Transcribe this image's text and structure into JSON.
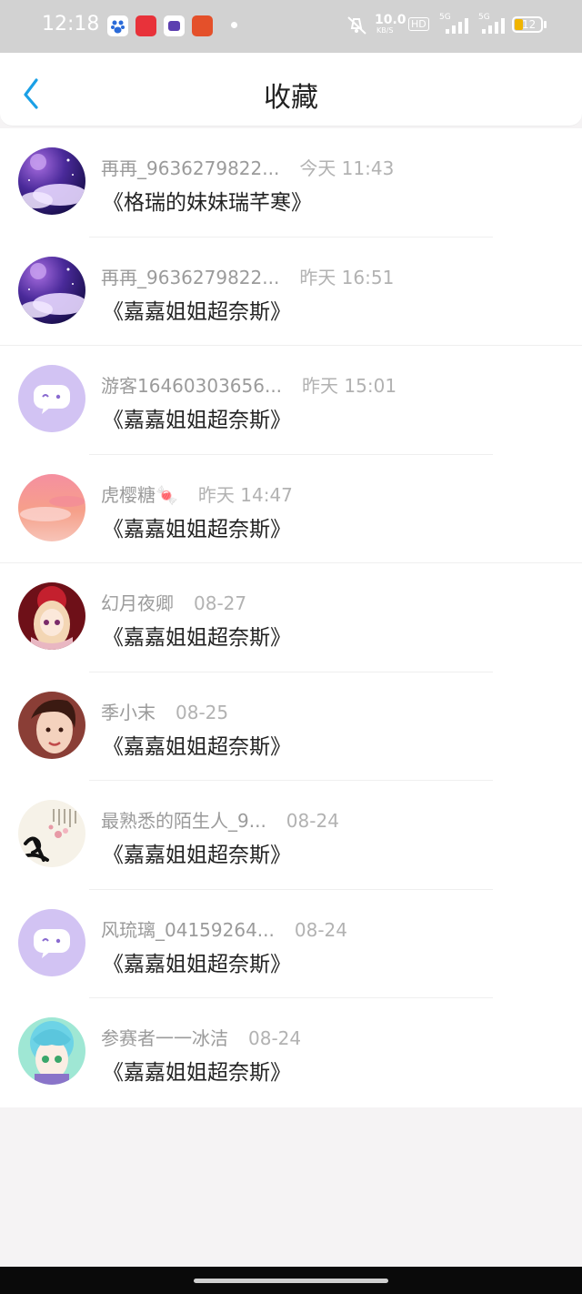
{
  "status_bar": {
    "time": "12:18",
    "network_speed": "10.0",
    "network_unit": "KB/S",
    "hd_label": "HD",
    "signal1_label": "5G",
    "signal2_label": "5G",
    "battery_level": "12",
    "colors": {
      "battery_fill": "#f0b400"
    },
    "apps": [
      "baidu-app-icon",
      "xiaohongshu-app-icon",
      "video-app-icon",
      "ting-app-icon"
    ]
  },
  "header": {
    "back_icon": "chevron-left-icon",
    "title": "收藏",
    "colors": {
      "back": "#1aa0e6"
    }
  },
  "favorites": [
    {
      "user": "再再_9636279822...",
      "time": "今天 11:43",
      "title": "《格瑞的妹妹瑞芊寒》",
      "avatar": "galaxy"
    },
    {
      "user": "再再_9636279822...",
      "time": "昨天 16:51",
      "title": "《嘉嘉姐姐超奈斯》",
      "avatar": "galaxy"
    },
    {
      "user": "游客16460303656...",
      "time": "昨天 15:01",
      "title": "《嘉嘉姐姐超奈斯》",
      "avatar": "default"
    },
    {
      "user": "虎樱糖🍬",
      "time": "昨天 14:47",
      "title": "《嘉嘉姐姐超奈斯》",
      "avatar": "sunset"
    },
    {
      "user": "幻月夜卿",
      "time": "08-27",
      "title": "《嘉嘉姐姐超奈斯》",
      "avatar": "anime-red"
    },
    {
      "user": "季小末",
      "time": "08-25",
      "title": "《嘉嘉姐姐超奈斯》",
      "avatar": "photo"
    },
    {
      "user": "最熟悉的陌生人_9...",
      "time": "08-24",
      "title": "《嘉嘉姐姐超奈斯》",
      "avatar": "calligraphy"
    },
    {
      "user": "风琉璃_04159264...",
      "time": "08-24",
      "title": "《嘉嘉姐姐超奈斯》",
      "avatar": "default"
    },
    {
      "user": "参赛者一一冰洁",
      "time": "08-24",
      "title": "《嘉嘉姐姐超奈斯》",
      "avatar": "anime-cyan"
    }
  ]
}
